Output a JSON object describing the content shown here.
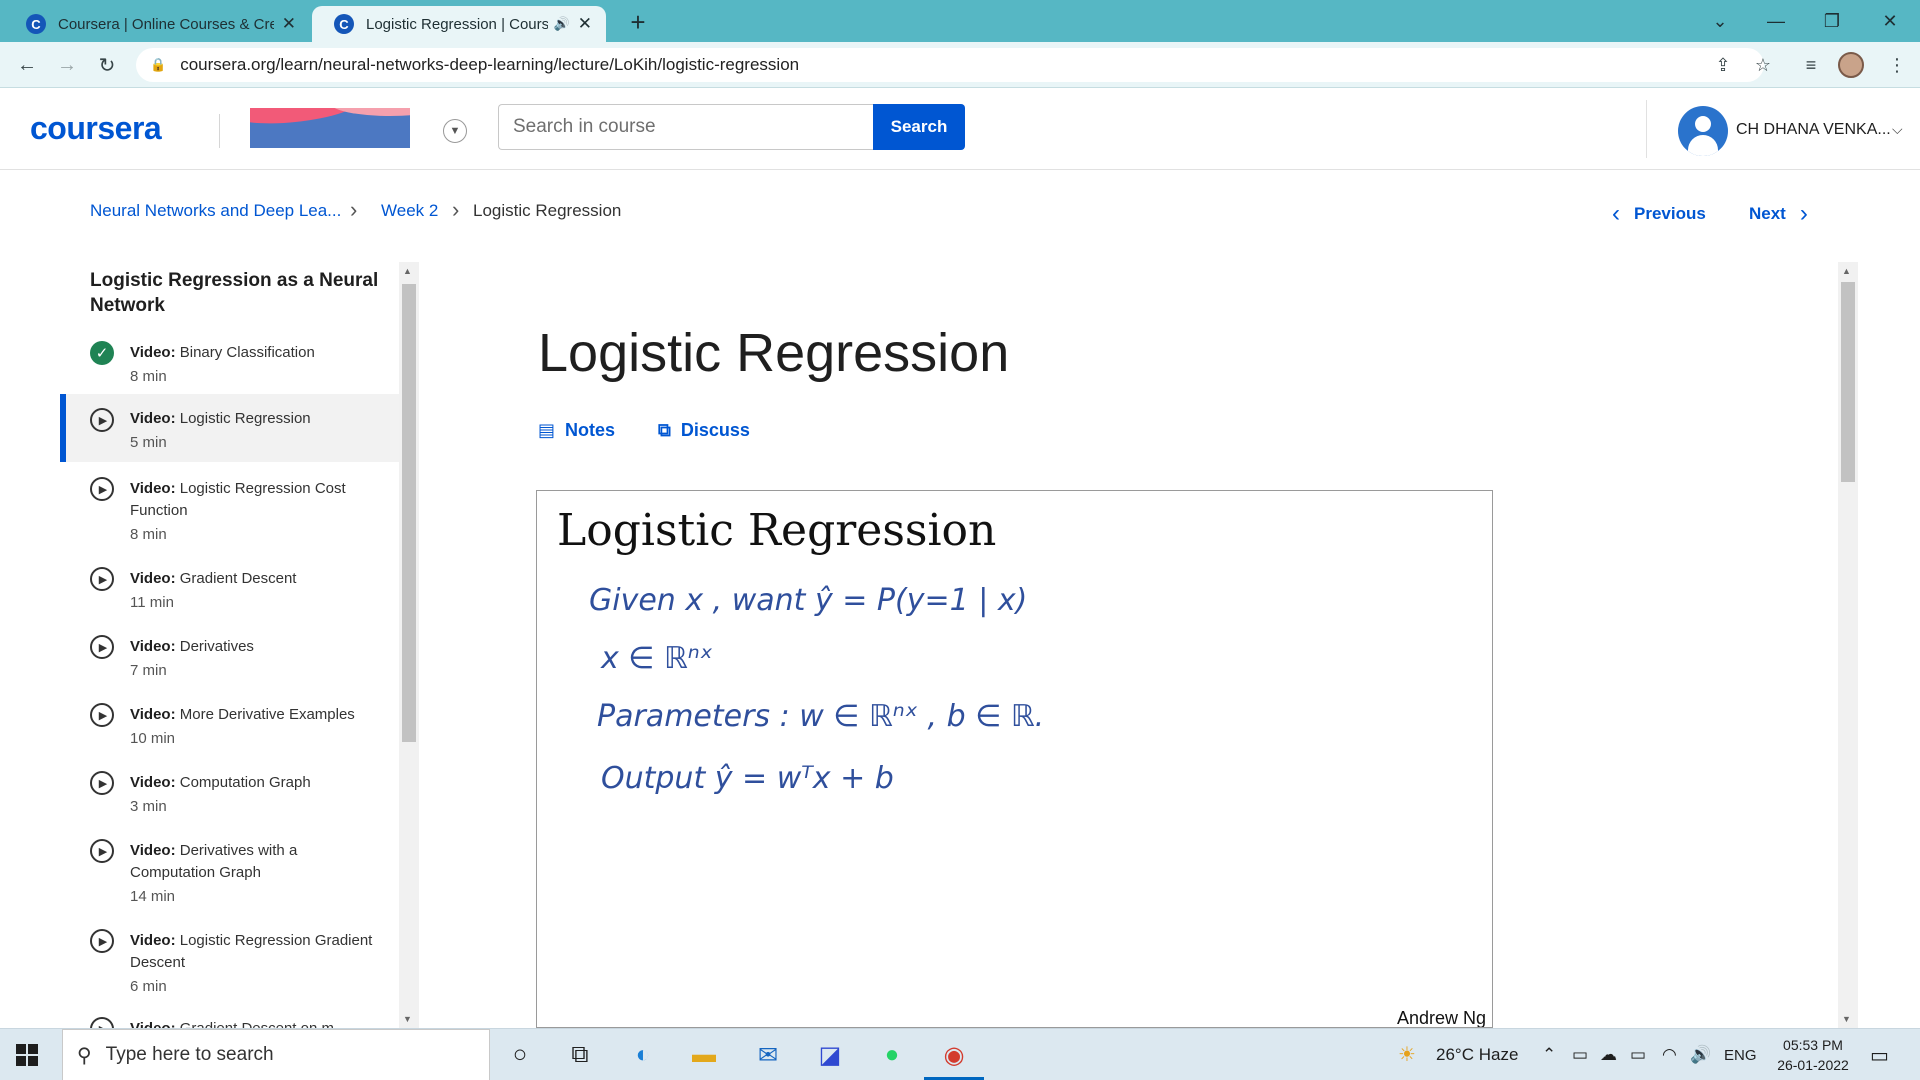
{
  "browser": {
    "tabs": [
      {
        "title": "Coursera | Online Courses & Cre",
        "active": false
      },
      {
        "title": "Logistic Regression | Courser",
        "active": true
      }
    ],
    "url": "coursera.org/learn/neural-networks-deep-learning/lecture/LoKih/logistic-regression"
  },
  "header": {
    "logo": "coursera",
    "search_placeholder": "Search in course",
    "search_button": "Search",
    "user_name": "CH DHANA VENKA..."
  },
  "breadcrumb": {
    "course": "Neural Networks and Deep Lea...",
    "week": "Week 2",
    "current": "Logistic Regression",
    "previous": "Previous",
    "next": "Next"
  },
  "sidebar": {
    "heading": "Logistic Regression as a Neural Network",
    "items": [
      {
        "type": "Video:",
        "title": "Binary Classification",
        "duration": "8 min",
        "status": "completed"
      },
      {
        "type": "Video:",
        "title": "Logistic Regression",
        "duration": "5 min",
        "status": "current"
      },
      {
        "type": "Video:",
        "title": "Logistic Regression Cost Function",
        "duration": "8 min",
        "status": "not-started"
      },
      {
        "type": "Video:",
        "title": "Gradient Descent",
        "duration": "11 min",
        "status": "not-started"
      },
      {
        "type": "Video:",
        "title": "Derivatives",
        "duration": "7 min",
        "status": "not-started"
      },
      {
        "type": "Video:",
        "title": "More Derivative Examples",
        "duration": "10 min",
        "status": "not-started"
      },
      {
        "type": "Video:",
        "title": "Computation Graph",
        "duration": "3 min",
        "status": "not-started"
      },
      {
        "type": "Video:",
        "title": "Derivatives with a Computation Graph",
        "duration": "14 min",
        "status": "not-started"
      },
      {
        "type": "Video:",
        "title": "Logistic Regression Gradient Descent",
        "duration": "6 min",
        "status": "not-started"
      },
      {
        "type": "Video:",
        "title": "Gradient Descent on m",
        "duration": "",
        "status": "not-started"
      }
    ]
  },
  "main": {
    "title": "Logistic Regression",
    "notes": "Notes",
    "discuss": "Discuss",
    "slide": {
      "title": "Logistic Regression",
      "lines": [
        "Given  x ,  want   ŷ = P(y=1 | x)",
        "x ∈ ℝⁿˣ",
        "Parameters :  w ∈ ℝⁿˣ ,   b ∈ ℝ.",
        "Output   ŷ =      wᵀx  + b"
      ],
      "author": "Andrew Ng"
    }
  },
  "taskbar": {
    "search_placeholder": "Type here to search",
    "weather": "26°C  Haze",
    "language": "ENG",
    "time": "05:53 PM",
    "date": "26-01-2022"
  },
  "colors": {
    "tabstrip": "#56b7c4",
    "coursera_blue": "#0056d2",
    "completed_green": "#1f8354",
    "handwriting": "#2f4f9c"
  }
}
